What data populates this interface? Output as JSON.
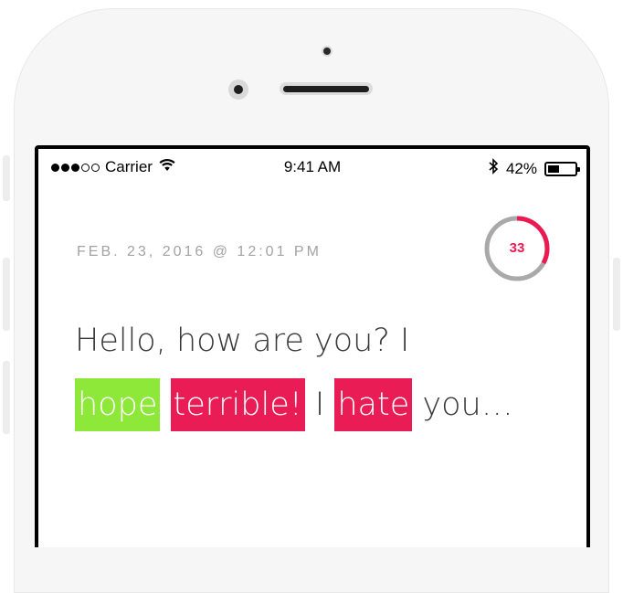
{
  "status_bar": {
    "carrier": "Carrier",
    "time": "9:41 AM",
    "battery_percent": "42%",
    "battery_level": 0.42,
    "signal_icon": "signal-dots-icon",
    "wifi_icon": "wifi-icon",
    "bluetooth_icon": "bluetooth-icon"
  },
  "timestamp": "FEB. 23, 2016 @ 12:01 PM",
  "score": {
    "value": "33",
    "progress": 0.33,
    "ring_color": "#eb1a52",
    "track_color": "#a9a9a9"
  },
  "message": {
    "line1": "Hello, how are you? I",
    "word_hope": "hope",
    "word_terrible": "terrible!",
    "word_i": "I",
    "word_hate": "hate",
    "word_you": "you…",
    "positive_color": "#8de83a",
    "negative_color": "#ea1c55"
  }
}
